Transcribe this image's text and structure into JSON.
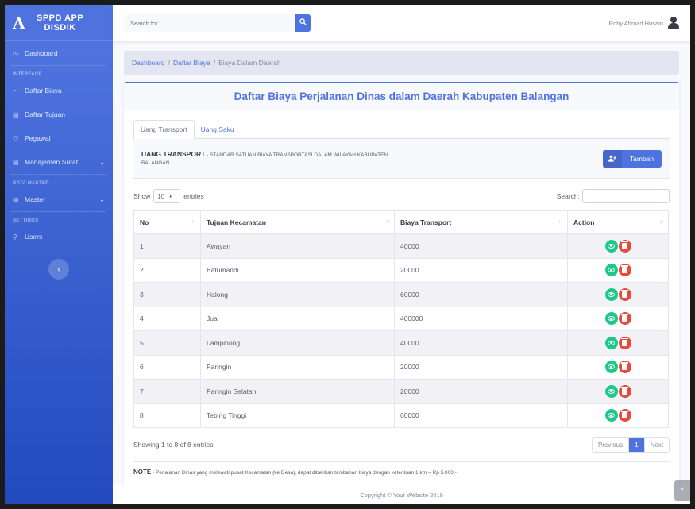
{
  "brand": {
    "logo": "A",
    "line1": "SPPD APP",
    "line2": "DISDIK"
  },
  "sidebar": {
    "dashboard": "Dashboard",
    "heading_interface": "INTERFACE",
    "daftar_biaya": "Daftar Biaya",
    "daftar_tujuan": "Daftar Tujuan",
    "pegawai": "Pegawai",
    "manajemen_surat": "Manajemen Surat",
    "heading_data_master": "DATA MASTER",
    "master": "Master",
    "heading_settings": "SETTINGS",
    "users": "Users",
    "toggle": "‹"
  },
  "topbar": {
    "search_placeholder": "Search for...",
    "user_name": "Roby Ahmad Husain"
  },
  "breadcrumb": {
    "item1": "Dashboard",
    "item2": "Daftar Biaya",
    "item3": "Biaya Dalam Daerah",
    "sep": "/"
  },
  "card": {
    "title": "Daftar Biaya Perjalanan Dinas dalam Daerah Kabupaten Balangan"
  },
  "tabs": {
    "tab1": "Uang Transport",
    "tab2": "Uang Saku"
  },
  "section": {
    "title_bold": "UANG TRANSPORT",
    "title_rest": " - STANDAR SATUAN BIAYA TRANSPORTASI DALAM WILAYAH KABUPATEN BALANGAN",
    "add_button": "Tambah"
  },
  "datatable": {
    "show": "Show",
    "length_value": "10",
    "entries": "entries",
    "search_label": "Search:",
    "columns": {
      "no": "No",
      "tujuan": "Tujuan Kecamatan",
      "biaya": "Biaya Transport",
      "action": "Action"
    },
    "rows": [
      {
        "no": "1",
        "tujuan": "Awayan",
        "biaya": "40000"
      },
      {
        "no": "2",
        "tujuan": "Batumandi",
        "biaya": "20000"
      },
      {
        "no": "3",
        "tujuan": "Halong",
        "biaya": "60000"
      },
      {
        "no": "4",
        "tujuan": "Juai",
        "biaya": "400000"
      },
      {
        "no": "5",
        "tujuan": "Lampihong",
        "biaya": "40000"
      },
      {
        "no": "6",
        "tujuan": "Paringin",
        "biaya": "20000"
      },
      {
        "no": "7",
        "tujuan": "Paringin Selatan",
        "biaya": "20000"
      },
      {
        "no": "8",
        "tujuan": "Tebing Tinggi",
        "biaya": "60000"
      }
    ],
    "info": "Showing 1 to 8 of 8 entries",
    "prev": "Previous",
    "page": "1",
    "next": "Next"
  },
  "note": {
    "label": "NOTE",
    "text": " - Perjalanan Dinas yang melewati pusat Kecamatan (ke Desa), dapat diberikan tambahan biaya dengan ketentuan 1 km = Rp 5.000,-"
  },
  "footer": {
    "copyright": "Copyright © Your Website 2019"
  },
  "colors": {
    "primary": "#4e73df",
    "success": "#1cc88a",
    "danger": "#e74a3b"
  }
}
